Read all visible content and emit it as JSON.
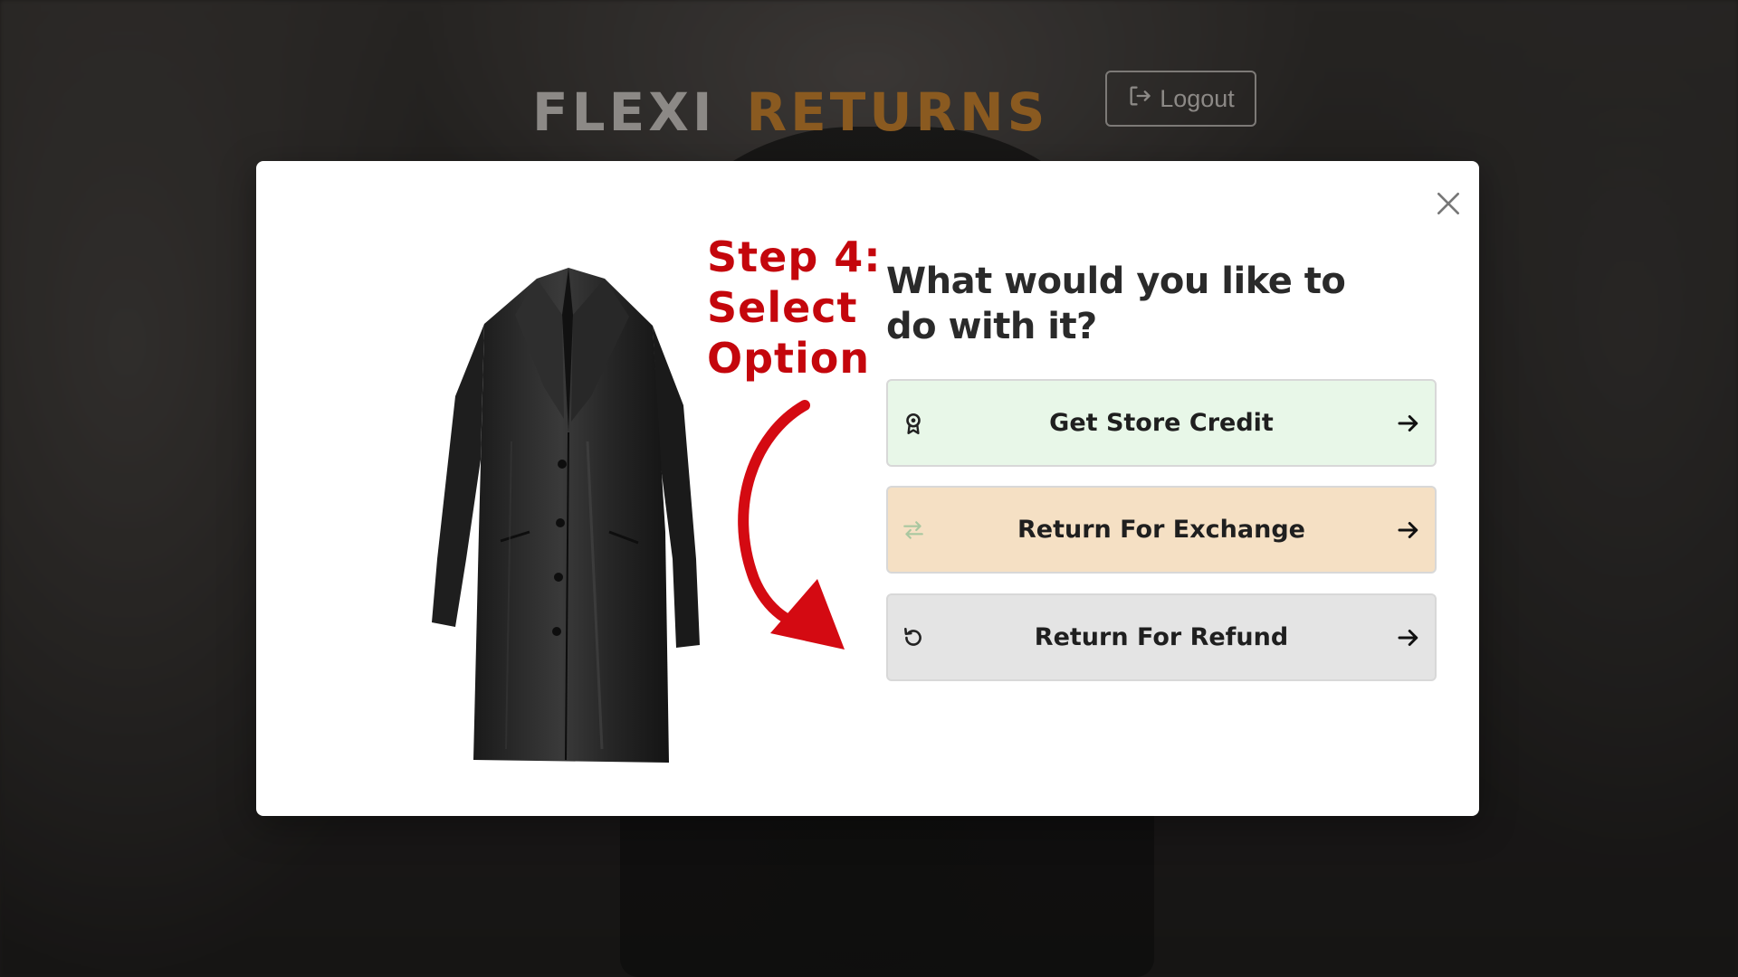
{
  "header": {
    "logo_part1": "FLEXI",
    "logo_part2": "RETURNS",
    "logout_label": "Logout"
  },
  "modal": {
    "annotation": {
      "line1": "Step 4:",
      "line2": "Select",
      "line3": "Option"
    },
    "question": "What would you like to do with it?",
    "options": [
      {
        "label": "Get Store Credit",
        "icon": "award-icon",
        "bg": "#e8f7e8"
      },
      {
        "label": "Return For Exchange",
        "icon": "exchange-icon",
        "bg": "#f5e0c4"
      },
      {
        "label": "Return For Refund",
        "icon": "undo-icon",
        "bg": "#e4e4e4"
      }
    ]
  },
  "colors": {
    "annotation_red": "#c4060c",
    "logo_orange": "#8a5a20"
  }
}
